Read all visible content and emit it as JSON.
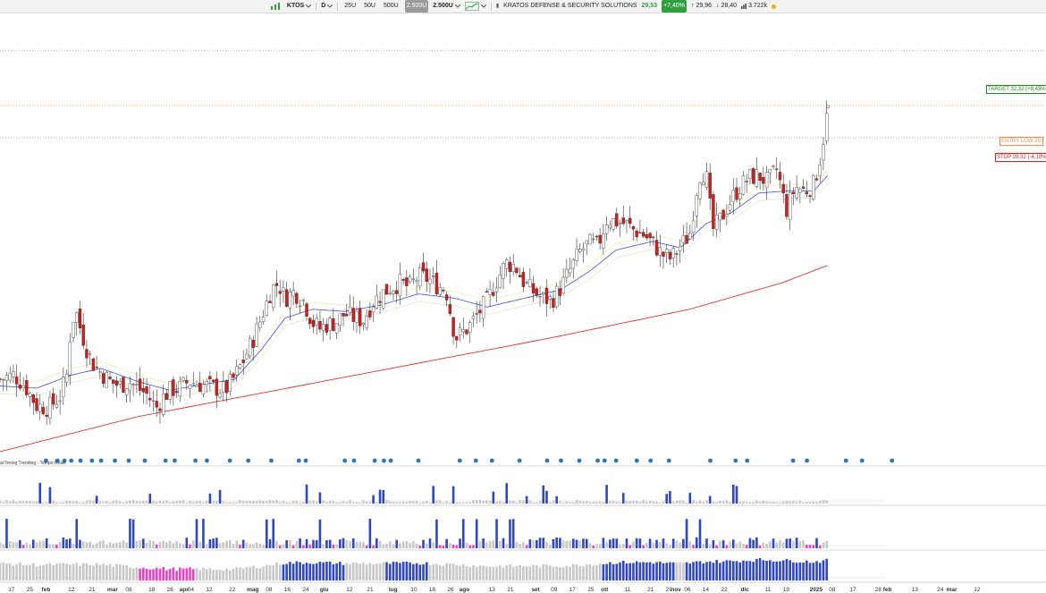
{
  "toolbar": {
    "symbol": "KTOS",
    "period": "D",
    "ranges": [
      "25U",
      "50U",
      "500U",
      "2.500U"
    ],
    "active_range": "2.500U",
    "bars_count": "2.500U",
    "company_name": "KRATOS DEFENSE & SECURITY SOLUTIONS",
    "last_price": "29,53",
    "change_pct": "+7,40%",
    "high": "29,96",
    "low": "28,40",
    "volume": "3.722k",
    "up_arrow": "↑",
    "down_arrow": "↓",
    "bar_icon": "▮"
  },
  "levels": {
    "target_label": "TARGET 32,32 (+9,45%)",
    "entry_label": "ENTRY LOW 29,",
    "stop_label": "STOP 28,32 (-4,10%)"
  },
  "indicator_label": "arTiming Trending - Tempo Reale",
  "colors": {
    "up": "#ffffff",
    "down": "#d21d1d",
    "ema_fast": "#3f4fd6",
    "sma_long": "#e03434",
    "target": "#1e8a1e",
    "entry": "#f08a4b",
    "stop": "#d42020",
    "marker": "#2b78b8",
    "bar_blue": "#2f47c4",
    "bar_gray": "#c8c8c8",
    "bar_pink": "#e842c0"
  },
  "chart_data": {
    "type": "candlestick",
    "ylim": [
      14.0,
      34.0
    ],
    "xlim_days": [
      0,
      455
    ],
    "x_date_start": "2024-01-12",
    "x_tick_labels": [
      {
        "label": "17",
        "day": 5
      },
      {
        "label": "25",
        "day": 13
      },
      {
        "label": "feb",
        "day": 20
      },
      {
        "label": "12",
        "day": 31
      },
      {
        "label": "21",
        "day": 40
      },
      {
        "label": "mar",
        "day": 49
      },
      {
        "label": "08",
        "day": 56
      },
      {
        "label": "18",
        "day": 66
      },
      {
        "label": "26",
        "day": 74
      },
      {
        "label": "apr",
        "day": 80
      },
      {
        "label": "04",
        "day": 83
      },
      {
        "label": "12",
        "day": 91
      },
      {
        "label": "22",
        "day": 101
      },
      {
        "label": "mag",
        "day": 110
      },
      {
        "label": "08",
        "day": 117
      },
      {
        "label": "16",
        "day": 125
      },
      {
        "label": "24",
        "day": 133
      },
      {
        "label": "giu",
        "day": 141
      },
      {
        "label": "12",
        "day": 152
      },
      {
        "label": "21",
        "day": 161
      },
      {
        "label": "lug",
        "day": 171
      },
      {
        "label": "10",
        "day": 180
      },
      {
        "label": "18",
        "day": 188
      },
      {
        "label": "26",
        "day": 196
      },
      {
        "label": "ago",
        "day": 202
      },
      {
        "label": "13",
        "day": 214
      },
      {
        "label": "21",
        "day": 222
      },
      {
        "label": "set",
        "day": 233
      },
      {
        "label": "09",
        "day": 241
      },
      {
        "label": "17",
        "day": 249
      },
      {
        "label": "25",
        "day": 257
      },
      {
        "label": "ott",
        "day": 263
      },
      {
        "label": "11",
        "day": 273
      },
      {
        "label": "21",
        "day": 283
      },
      {
        "label": "29",
        "day": 291
      },
      {
        "label": "nov",
        "day": 294
      },
      {
        "label": "06",
        "day": 299
      },
      {
        "label": "14",
        "day": 307
      },
      {
        "label": "22",
        "day": 315
      },
      {
        "label": "dic",
        "day": 324
      },
      {
        "label": "11",
        "day": 334
      },
      {
        "label": "19",
        "day": 342
      },
      {
        "label": "2025",
        "day": 355
      },
      {
        "label": "08",
        "day": 362
      },
      {
        "label": "17",
        "day": 371
      },
      {
        "label": "28",
        "day": 382
      },
      {
        "label": "feb",
        "day": 386
      },
      {
        "label": "13",
        "day": 398
      },
      {
        "label": "24",
        "day": 409
      },
      {
        "label": "mar",
        "day": 414
      },
      {
        "label": "12",
        "day": 425
      }
    ],
    "close_anchors": [
      [
        0,
        17.3
      ],
      [
        6,
        17.5
      ],
      [
        11,
        17.0
      ],
      [
        16,
        16.1
      ],
      [
        21,
        16.0
      ],
      [
        26,
        16.5
      ],
      [
        29,
        17.5
      ],
      [
        31,
        19.9
      ],
      [
        33,
        20.4
      ],
      [
        35,
        19.6
      ],
      [
        38,
        18.6
      ],
      [
        41,
        17.9
      ],
      [
        44,
        17.6
      ],
      [
        48,
        17.2
      ],
      [
        52,
        17.0
      ],
      [
        56,
        17.2
      ],
      [
        60,
        16.9
      ],
      [
        64,
        16.6
      ],
      [
        68,
        16.0
      ],
      [
        71,
        16.5
      ],
      [
        74,
        16.8
      ],
      [
        78,
        16.9
      ],
      [
        82,
        17.2
      ],
      [
        86,
        17.1
      ],
      [
        90,
        17.0
      ],
      [
        94,
        16.9
      ],
      [
        98,
        16.8
      ],
      [
        102,
        17.4
      ],
      [
        106,
        18.2
      ],
      [
        110,
        19.1
      ],
      [
        114,
        20.2
      ],
      [
        118,
        21.4
      ],
      [
        121,
        21.7
      ],
      [
        124,
        21.0
      ],
      [
        128,
        21.3
      ],
      [
        132,
        20.9
      ],
      [
        136,
        19.9
      ],
      [
        139,
        19.6
      ],
      [
        142,
        19.8
      ],
      [
        146,
        19.9
      ],
      [
        150,
        20.3
      ],
      [
        154,
        20.1
      ],
      [
        158,
        20.0
      ],
      [
        162,
        20.8
      ],
      [
        166,
        21.2
      ],
      [
        170,
        21.5
      ],
      [
        174,
        21.7
      ],
      [
        178,
        21.5
      ],
      [
        182,
        22.0
      ],
      [
        186,
        21.9
      ],
      [
        190,
        21.6
      ],
      [
        194,
        21.4
      ],
      [
        198,
        19.2
      ],
      [
        201,
        19.4
      ],
      [
        204,
        19.7
      ],
      [
        208,
        20.3
      ],
      [
        212,
        20.9
      ],
      [
        216,
        21.8
      ],
      [
        220,
        22.6
      ],
      [
        224,
        22.5
      ],
      [
        228,
        21.7
      ],
      [
        232,
        21.3
      ],
      [
        236,
        21.0
      ],
      [
        240,
        20.9
      ],
      [
        244,
        21.5
      ],
      [
        248,
        22.3
      ],
      [
        252,
        23.1
      ],
      [
        256,
        23.5
      ],
      [
        260,
        23.4
      ],
      [
        264,
        24.6
      ],
      [
        268,
        24.5
      ],
      [
        272,
        24.4
      ],
      [
        276,
        24.1
      ],
      [
        280,
        23.9
      ],
      [
        284,
        23.5
      ],
      [
        288,
        23.0
      ],
      [
        292,
        22.8
      ],
      [
        296,
        23.4
      ],
      [
        300,
        23.9
      ],
      [
        304,
        26.6
      ],
      [
        307,
        26.8
      ],
      [
        310,
        24.1
      ],
      [
        314,
        24.7
      ],
      [
        318,
        25.5
      ],
      [
        322,
        26.1
      ],
      [
        326,
        26.5
      ],
      [
        330,
        26.6
      ],
      [
        334,
        26.3
      ],
      [
        338,
        26.9
      ],
      [
        342,
        25.0
      ],
      [
        346,
        26.1
      ],
      [
        350,
        25.9
      ],
      [
        354,
        26.2
      ],
      [
        357,
        27.5
      ],
      [
        360,
        29.53
      ]
    ],
    "ema_anchors": [
      [
        0,
        17.0
      ],
      [
        16,
        16.9
      ],
      [
        31,
        17.5
      ],
      [
        44,
        17.8
      ],
      [
        60,
        17.2
      ],
      [
        74,
        16.8
      ],
      [
        90,
        17.1
      ],
      [
        102,
        17.3
      ],
      [
        114,
        18.7
      ],
      [
        124,
        20.1
      ],
      [
        136,
        20.5
      ],
      [
        150,
        20.4
      ],
      [
        166,
        20.7
      ],
      [
        182,
        21.2
      ],
      [
        198,
        21.0
      ],
      [
        212,
        20.6
      ],
      [
        228,
        21.0
      ],
      [
        244,
        21.4
      ],
      [
        256,
        22.2
      ],
      [
        268,
        23.2
      ],
      [
        284,
        23.6
      ],
      [
        296,
        23.3
      ],
      [
        307,
        24.4
      ],
      [
        318,
        24.9
      ],
      [
        330,
        25.8
      ],
      [
        342,
        25.9
      ],
      [
        354,
        25.9
      ],
      [
        360,
        26.6
      ]
    ],
    "sma200_anchors": [
      [
        0,
        14.0
      ],
      [
        60,
        15.6
      ],
      [
        120,
        16.8
      ],
      [
        180,
        18.0
      ],
      [
        240,
        19.2
      ],
      [
        300,
        20.5
      ],
      [
        340,
        21.7
      ],
      [
        360,
        22.5
      ]
    ],
    "levels": {
      "target": 32.32,
      "entry_low": 29.8,
      "stop": 28.32
    },
    "indicator_marker_days": [
      20,
      25,
      28,
      31,
      35,
      40,
      44,
      50,
      56,
      63,
      72,
      76,
      85,
      90,
      100,
      108,
      118,
      130,
      133,
      150,
      154,
      163,
      167,
      170,
      182,
      200,
      207,
      214,
      226,
      238,
      244,
      252,
      260,
      263,
      268,
      277,
      283,
      291,
      309,
      320,
      325,
      345,
      351,
      368,
      375,
      388
    ],
    "volume_panels": 3
  }
}
